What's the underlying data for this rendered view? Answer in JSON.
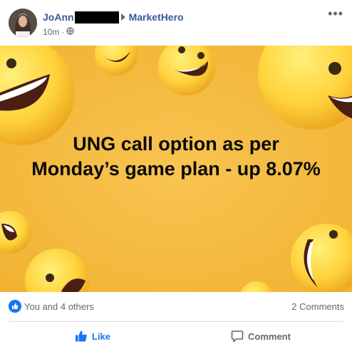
{
  "post": {
    "author": "JoAnn",
    "group": "MarketHero",
    "time": "10m",
    "privacy_icon": "public-globe-icon",
    "more_label": "•••"
  },
  "image": {
    "caption": "UNG call option as per Monday’s game plan - up 8.07%",
    "background_color": "#f5b93c",
    "decoration": "laughing-emoji-faces"
  },
  "reactions": {
    "summary": "You and 4 others",
    "comments": "2 Comments",
    "icon": "like-icon"
  },
  "actions": {
    "like_label": "Like",
    "comment_label": "Comment"
  },
  "colors": {
    "link": "#385898",
    "accent": "#1877f2",
    "muted": "#606770"
  }
}
